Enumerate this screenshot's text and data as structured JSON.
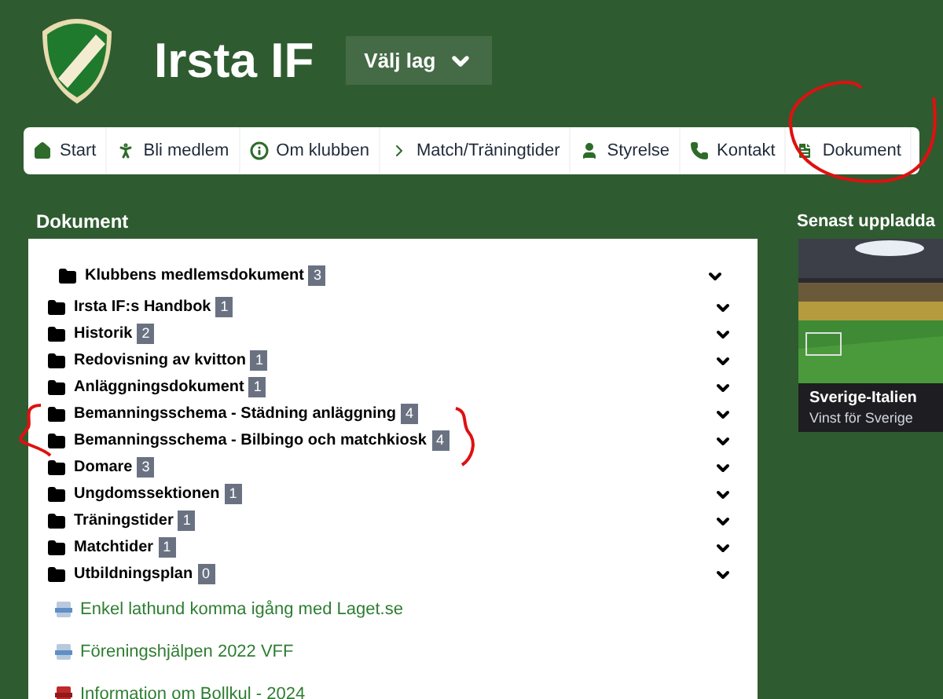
{
  "site": {
    "title": "Irsta IF",
    "team_select": "Välj lag"
  },
  "nav": [
    {
      "label": "Start"
    },
    {
      "label": "Bli medlem"
    },
    {
      "label": "Om klubben"
    },
    {
      "label": "Match/Träningtider"
    },
    {
      "label": "Styrelse"
    },
    {
      "label": "Kontakt"
    },
    {
      "label": "Dokument"
    }
  ],
  "documents": {
    "title": "Dokument",
    "items": [
      {
        "kind": "top",
        "label": "Klubbens medlemsdokument",
        "count": "3"
      },
      {
        "kind": "folder",
        "label": "Irsta IF:s Handbok",
        "count": "1"
      },
      {
        "kind": "folder",
        "label": "Historik",
        "count": "2"
      },
      {
        "kind": "folder",
        "label": "Redovisning av kvitton",
        "count": "1"
      },
      {
        "kind": "folder",
        "label": "Anläggningsdokument",
        "count": "1"
      },
      {
        "kind": "folder",
        "label": "Bemanningsschema - Städning anläggning",
        "count": "4"
      },
      {
        "kind": "folder",
        "label": "Bemanningsschema - Bilbingo och matchkiosk",
        "count": "4"
      },
      {
        "kind": "folder",
        "label": "Domare",
        "count": "3"
      },
      {
        "kind": "folder",
        "label": "Ungdomssektionen",
        "count": "1"
      },
      {
        "kind": "folder",
        "label": "Träningstider",
        "count": "1"
      },
      {
        "kind": "folder",
        "label": "Matchtider",
        "count": "1"
      },
      {
        "kind": "folder",
        "label": "Utbildningsplan",
        "count": "0"
      },
      {
        "kind": "doc",
        "label": "Enkel lathund komma igång med Laget.se"
      },
      {
        "kind": "doc",
        "label": "Föreningshjälpen 2022 VFF"
      },
      {
        "kind": "pdf",
        "label": "Information om Bollkul - 2024"
      }
    ]
  },
  "latest": {
    "title": "Senast uppladda",
    "caption": "Sverige-Italien",
    "subcaption": "Vinst för Sverige"
  }
}
